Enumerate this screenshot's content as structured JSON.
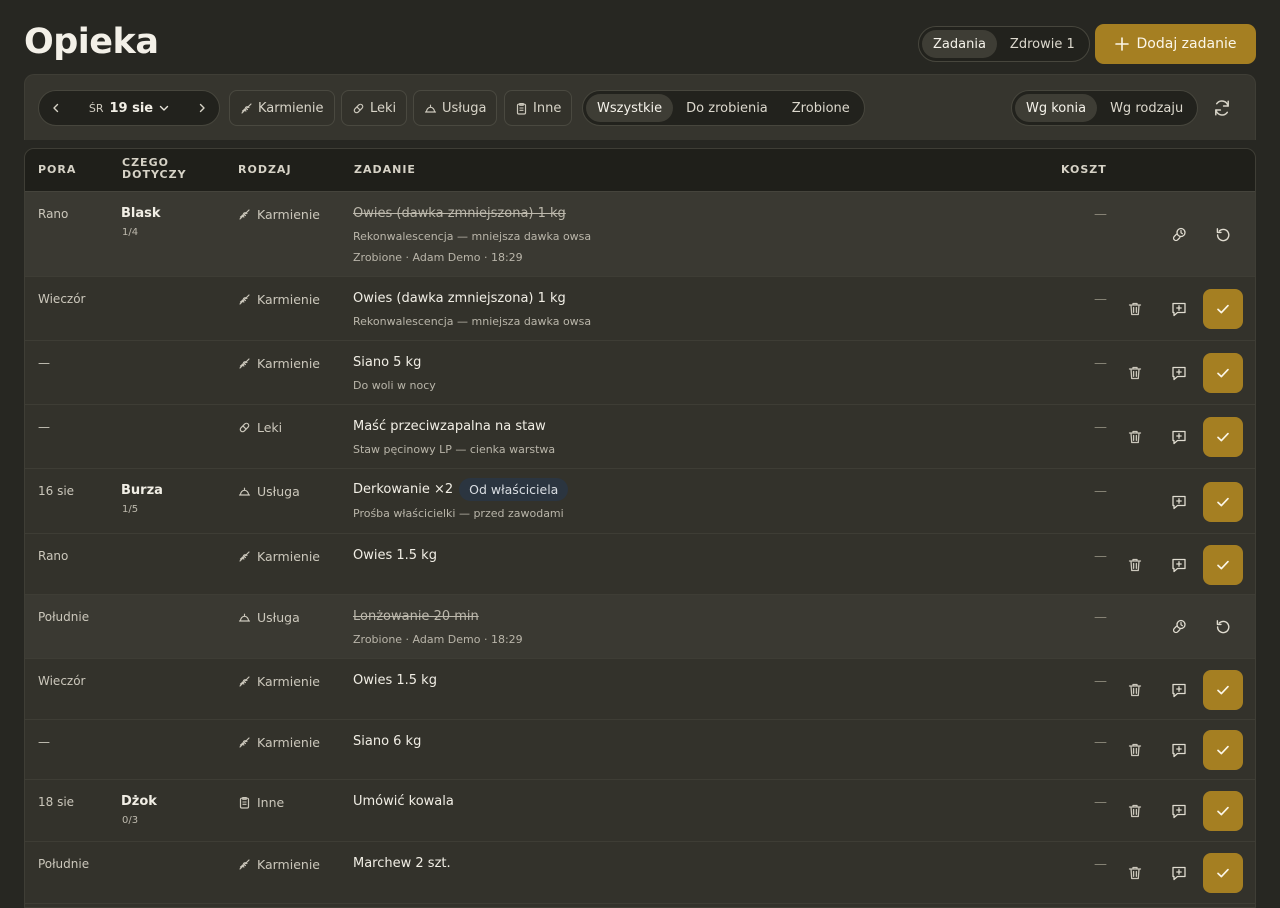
{
  "page": {
    "title": "Opieka"
  },
  "top_tabs": [
    {
      "label": "Zadania",
      "active": true
    },
    {
      "label": "Zdrowie 1",
      "active": false
    }
  ],
  "add_button": {
    "label": "Dodaj zadanie"
  },
  "toolbar": {
    "date": {
      "dow": "ŚR",
      "value": "19 sie"
    },
    "categories": [
      {
        "label": "Karmienie",
        "icon": "feed-icon"
      },
      {
        "label": "Leki",
        "icon": "pill-icon"
      },
      {
        "label": "Usługa",
        "icon": "service-icon"
      },
      {
        "label": "Inne",
        "icon": "clipboard-icon"
      }
    ],
    "status_filters": [
      {
        "label": "Wszystkie",
        "active": true
      },
      {
        "label": "Do zrobienia",
        "active": false
      },
      {
        "label": "Zrobione",
        "active": false
      }
    ],
    "group_by": [
      {
        "label": "Wg konia",
        "active": true
      },
      {
        "label": "Wg rodzaju",
        "active": false
      }
    ]
  },
  "table": {
    "columns": [
      "PORA",
      "CZEGO DOTYCZY",
      "RODZAJ",
      "ZADANIE",
      "KOSZT"
    ],
    "rows": [
      {
        "pora": "Rano",
        "horse": "Blask",
        "count": "1/4",
        "kind": "Karmienie",
        "title": "Owies (dawka zmniejszona) 1 kg",
        "sub1": "Rekonwalescencja — mniejsza dawka owsa",
        "sub2": "Zrobione · Adam Demo · 18:29",
        "cost": "—",
        "done": true
      },
      {
        "pora": "Wieczór",
        "horse": "",
        "count": "",
        "kind": "Karmienie",
        "title": "Owies (dawka zmniejszona) 1 kg",
        "sub1": "Rekonwalescencja — mniejsza dawka owsa",
        "sub2": "",
        "cost": "—",
        "done": false
      },
      {
        "pora": "—",
        "horse": "",
        "count": "",
        "kind": "Karmienie",
        "title": "Siano 5 kg",
        "sub1": "Do woli w nocy",
        "sub2": "",
        "cost": "—",
        "done": false
      },
      {
        "pora": "—",
        "horse": "",
        "count": "",
        "kind": "Leki",
        "title": "Maść przeciwzapalna na staw",
        "sub1": "Staw pęcinowy LP — cienka warstwa",
        "sub2": "",
        "cost": "—",
        "done": false
      },
      {
        "pora": "16 sie",
        "horse": "Burza",
        "count": "1/5",
        "kind": "Usługa",
        "title": "Derkowanie ×2",
        "badge": "Od właściciela",
        "sub1": "Prośba właścicielki — przed zawodami",
        "sub2": "",
        "cost": "—",
        "done": false
      },
      {
        "pora": "Rano",
        "horse": "",
        "count": "",
        "kind": "Karmienie",
        "title": "Owies 1.5 kg",
        "sub1": "",
        "sub2": "",
        "cost": "—",
        "done": false
      },
      {
        "pora": "Południe",
        "horse": "",
        "count": "",
        "kind": "Usługa",
        "title": "Lonżowanie 20 min",
        "sub1": "Zrobione · Adam Demo · 18:29",
        "sub2": "",
        "cost": "—",
        "done": true
      },
      {
        "pora": "Wieczór",
        "horse": "",
        "count": "",
        "kind": "Karmienie",
        "title": "Owies 1.5 kg",
        "sub1": "",
        "sub2": "",
        "cost": "—",
        "done": false
      },
      {
        "pora": "—",
        "horse": "",
        "count": "",
        "kind": "Karmienie",
        "title": "Siano 6 kg",
        "sub1": "",
        "sub2": "",
        "cost": "—",
        "done": false
      },
      {
        "pora": "18 sie",
        "horse": "Dżok",
        "count": "0/3",
        "kind": "Inne",
        "title": "Umówić kowala",
        "sub1": "",
        "sub2": "",
        "cost": "—",
        "done": false
      },
      {
        "pora": "Południe",
        "horse": "",
        "count": "",
        "kind": "Karmienie",
        "title": "Marchew 2 szt.",
        "sub1": "",
        "sub2": "",
        "cost": "—",
        "done": false
      }
    ]
  },
  "colors": {
    "accent": "#a57f22",
    "background": "#272722",
    "panel": "#33322b",
    "badge": "#2b3540"
  }
}
